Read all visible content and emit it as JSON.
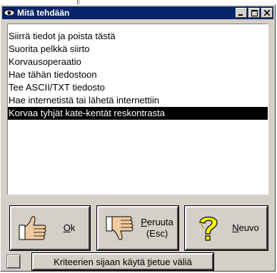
{
  "window": {
    "title": "Mitä tehdään",
    "minimize_symbol": "_",
    "maximize_symbol": "□",
    "close_symbol": "×"
  },
  "list": {
    "items": [
      "Siirrä tiedot ja poista tästä",
      "Suorita pelkkä siirto",
      "Korvausoperaatio",
      "Hae tähän tiedostoon",
      "Tee ASCII/TXT tiedosto",
      "Hae internetistä tai lähetä internettiin",
      "Korvaa tyhjät kate-kentät reskontrasta"
    ],
    "selected_index": 6
  },
  "buttons": {
    "ok": {
      "mnemonic": "O",
      "rest": "k"
    },
    "cancel": {
      "mnemonic": "P",
      "rest": "eruuta",
      "line2": "(Esc)"
    },
    "help": {
      "mnemonic": "N",
      "rest": "euvo"
    }
  },
  "criteria": {
    "checked": false,
    "label_before": "Kriteerien sijaan käytä ",
    "mnemonic": "t",
    "label_after": "ietue väliä"
  },
  "colors": {
    "titlebar": "#0a246a",
    "face": "#d4d0c8",
    "selection": "#000000"
  }
}
